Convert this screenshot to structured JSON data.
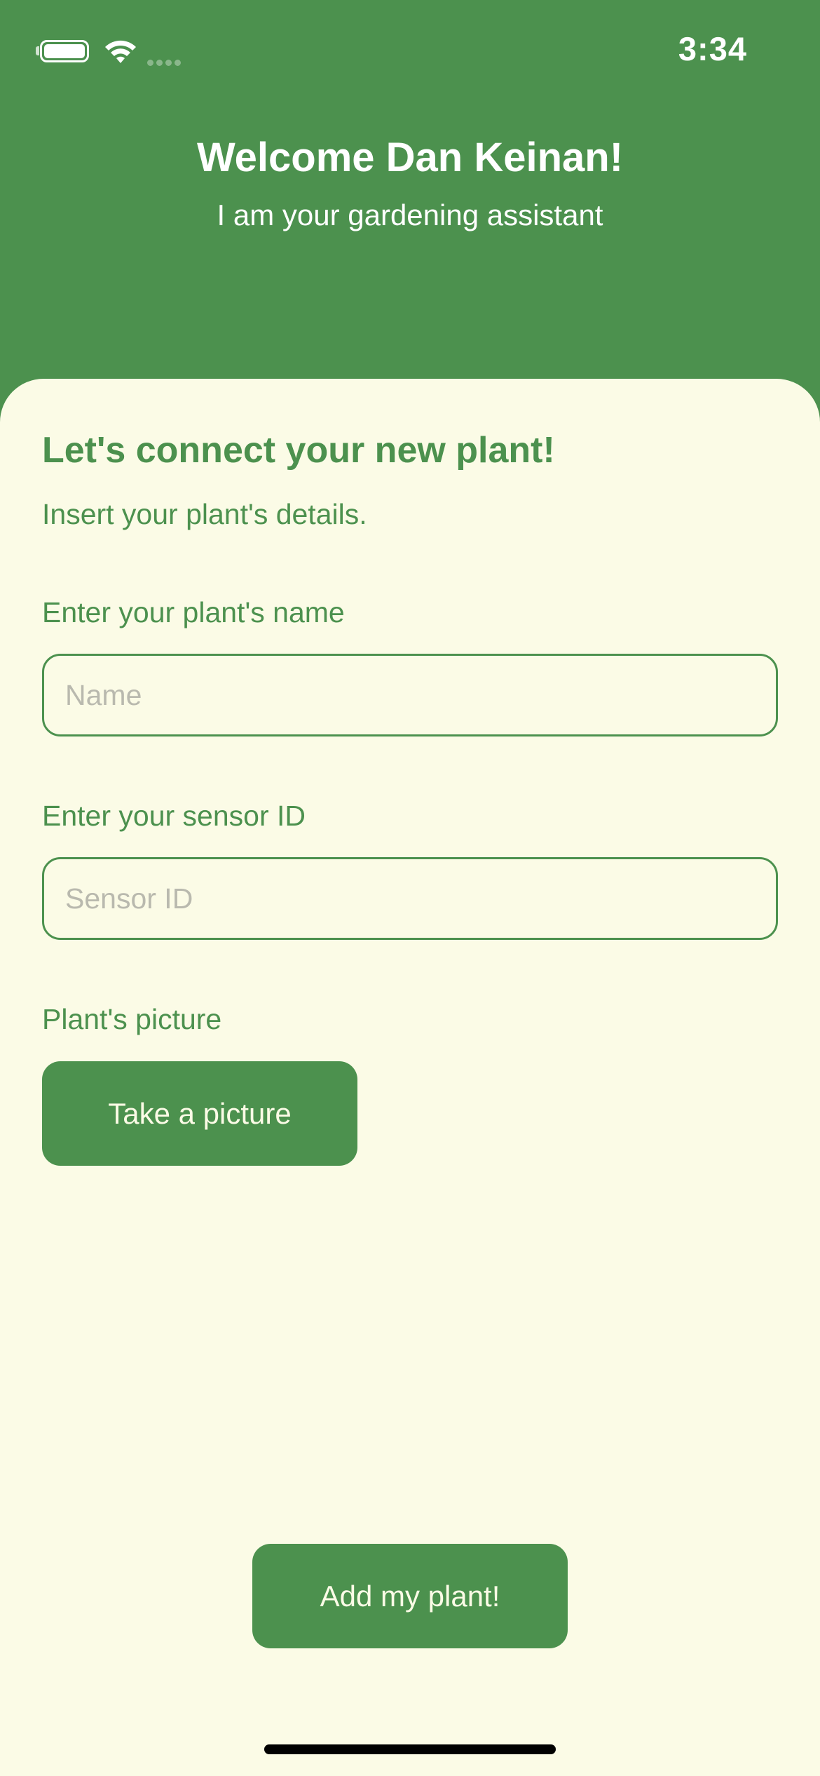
{
  "status_bar": {
    "time": "3:34",
    "battery_icon": "battery-icon",
    "wifi_icon": "wifi-icon",
    "signal_icon": "cellular-signal-icon"
  },
  "header": {
    "welcome": "Welcome Dan Keinan!",
    "subtitle": "I am your gardening assistant"
  },
  "form": {
    "title": "Let's connect your new plant!",
    "subtitle": "Insert your plant's details.",
    "name_label": "Enter your plant's name",
    "name_placeholder": "Name",
    "name_value": "",
    "sensor_label": "Enter your sensor ID",
    "sensor_placeholder": "Sensor ID",
    "sensor_value": "",
    "picture_label": "Plant's picture",
    "take_picture_button": "Take a picture",
    "submit_button": "Add my plant!"
  },
  "colors": {
    "primary_green": "#4c914e",
    "background_cream": "#fbfbe6",
    "placeholder_gray": "#b9b9ae"
  }
}
